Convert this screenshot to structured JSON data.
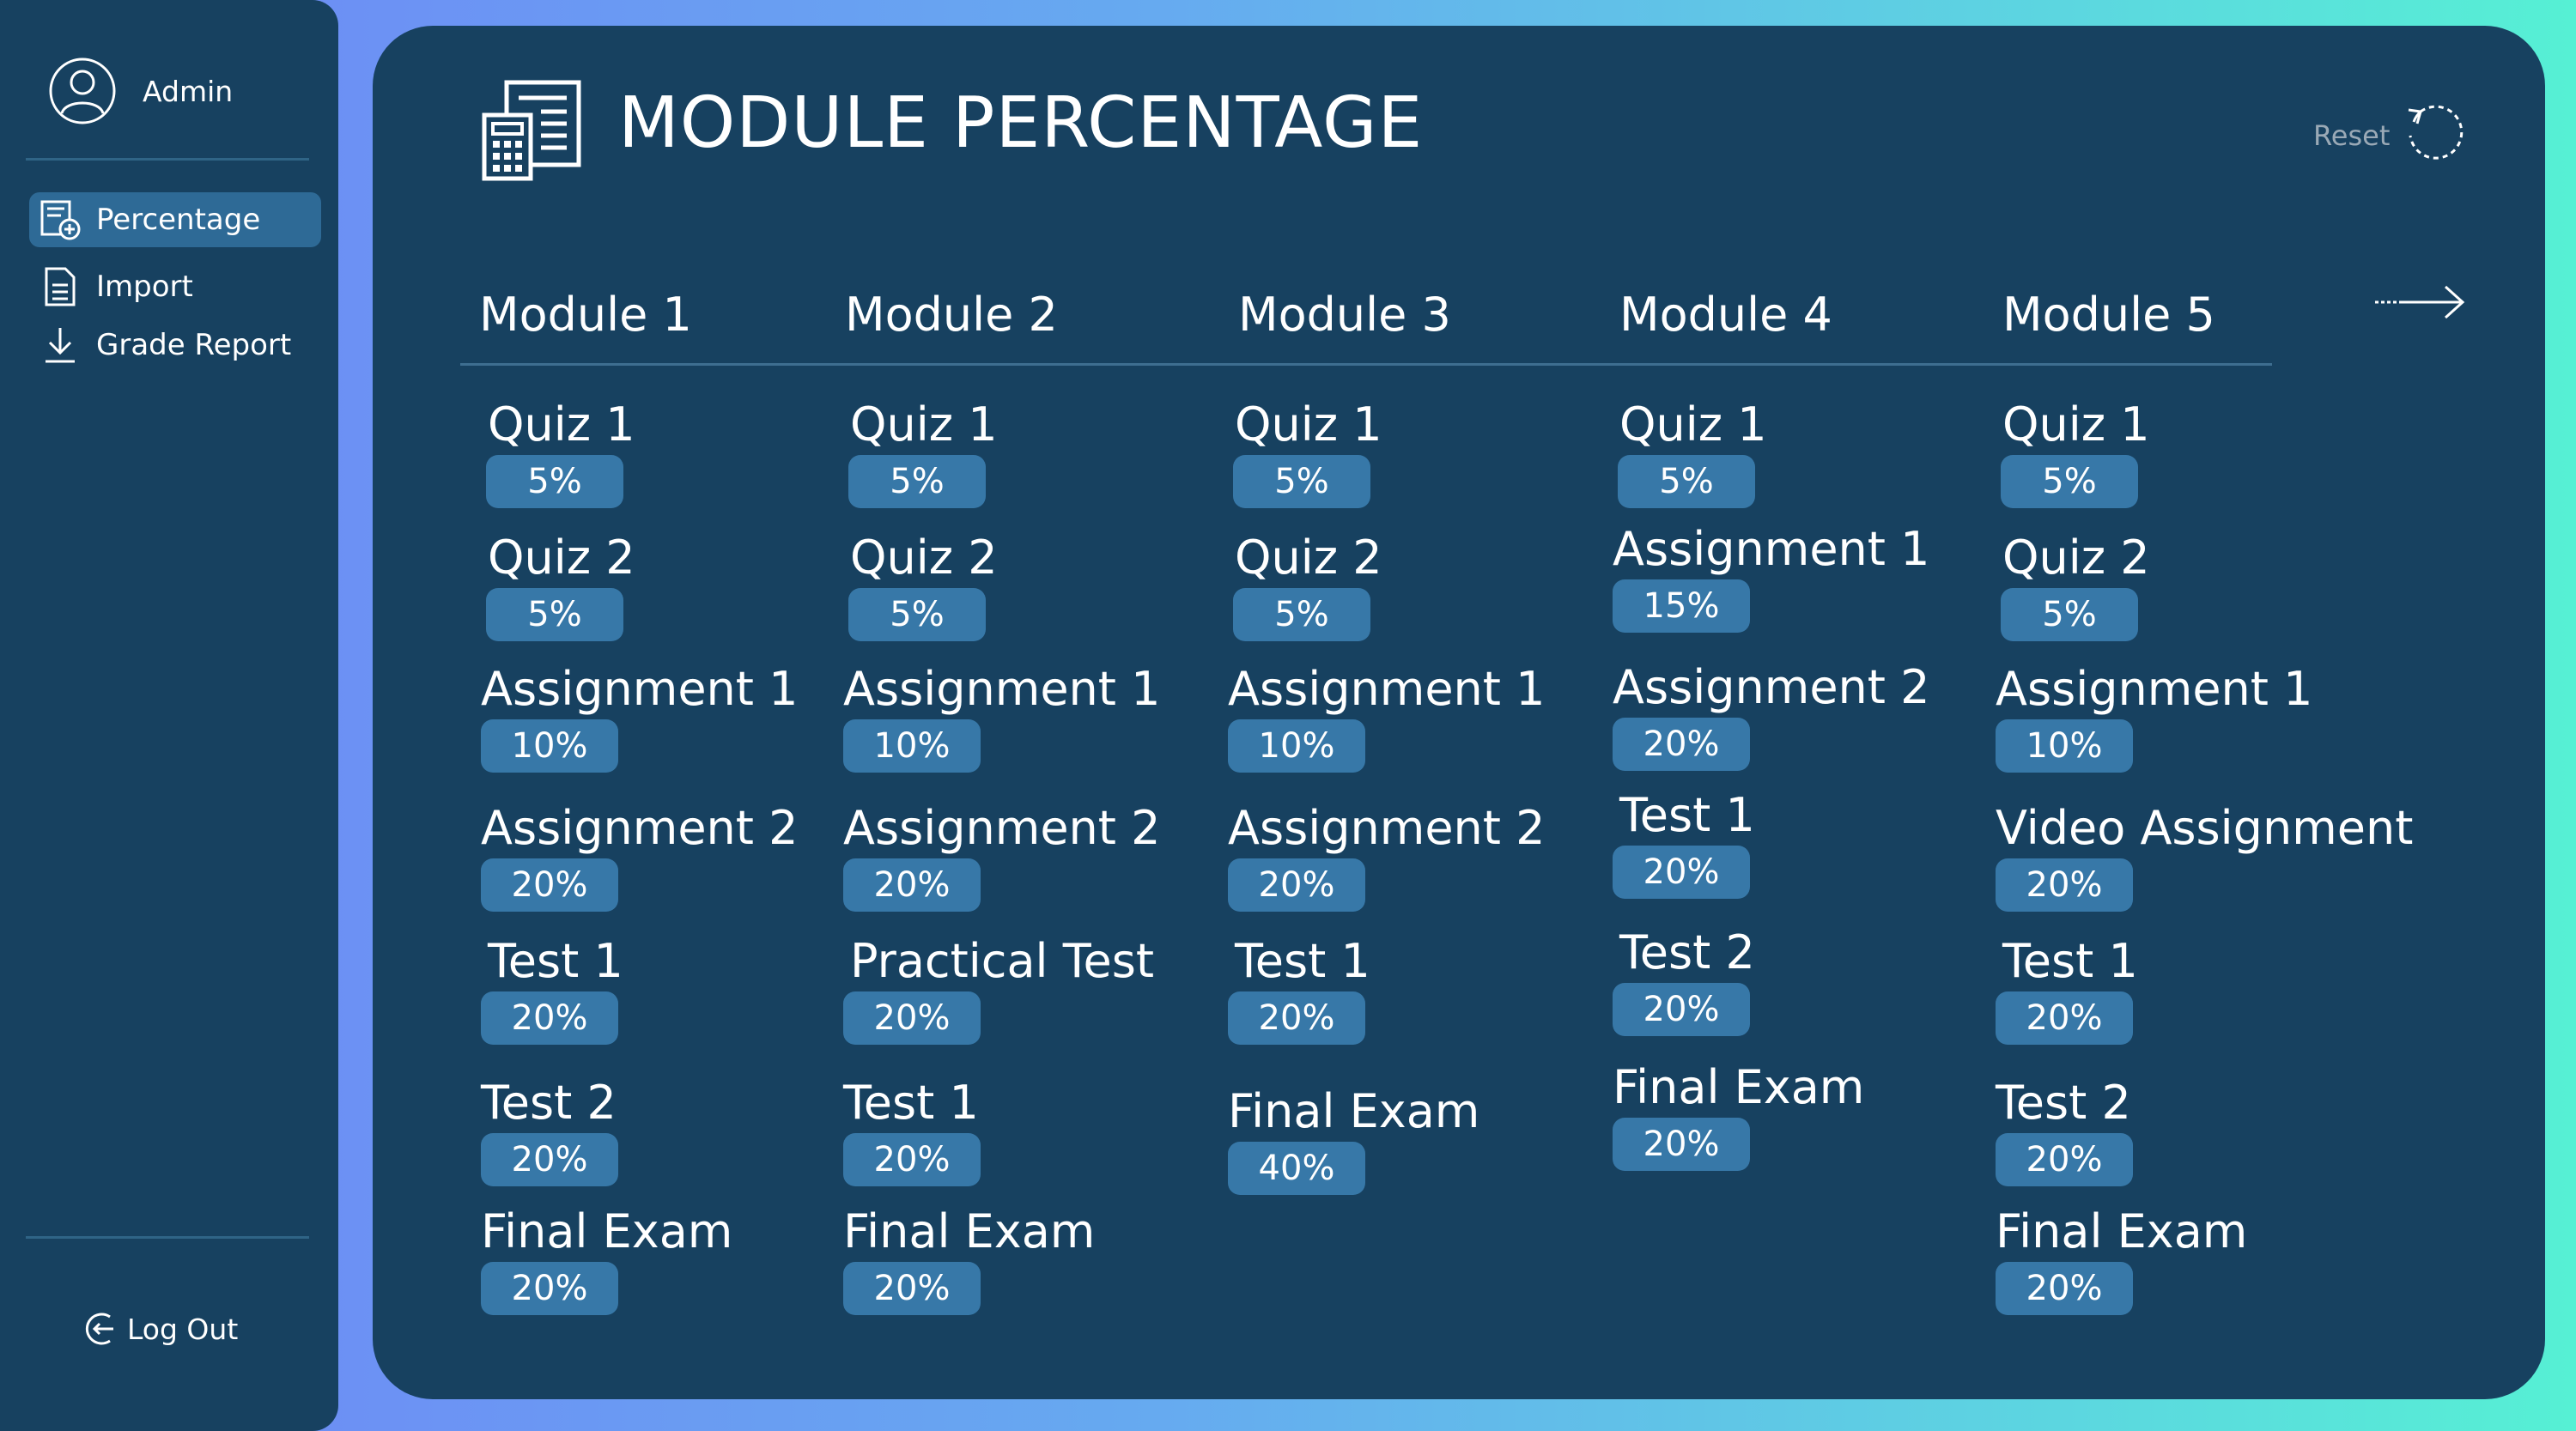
{
  "sidebar": {
    "user": "Admin",
    "nav": [
      {
        "label": "Percentage",
        "icon": "percentage-icon"
      },
      {
        "label": "Import",
        "icon": "document-icon"
      },
      {
        "label": "Grade Report",
        "icon": "download-icon"
      }
    ],
    "logout": "Log Out"
  },
  "header": {
    "title": "MODULE PERCENTAGE",
    "reset": "Reset"
  },
  "modules": [
    {
      "name": "Module 1",
      "items": [
        {
          "name": "Quiz 1",
          "pct": "5%"
        },
        {
          "name": "Quiz 2",
          "pct": "5%"
        },
        {
          "name": "Assignment 1",
          "pct": "10%"
        },
        {
          "name": "Assignment 2",
          "pct": "20%"
        },
        {
          "name": "Test 1",
          "pct": "20%"
        },
        {
          "name": "Test 2",
          "pct": "20%"
        },
        {
          "name": "Final Exam",
          "pct": "20%"
        }
      ]
    },
    {
      "name": "Module 2",
      "items": [
        {
          "name": "Quiz 1",
          "pct": "5%"
        },
        {
          "name": "Quiz 2",
          "pct": "5%"
        },
        {
          "name": "Assignment 1",
          "pct": "10%"
        },
        {
          "name": "Assignment 2",
          "pct": "20%"
        },
        {
          "name": "Practical Test",
          "pct": "20%"
        },
        {
          "name": "Test 1",
          "pct": "20%"
        },
        {
          "name": "Final Exam",
          "pct": "20%"
        }
      ]
    },
    {
      "name": "Module 3",
      "items": [
        {
          "name": "Quiz 1",
          "pct": "5%"
        },
        {
          "name": "Quiz 2",
          "pct": "5%"
        },
        {
          "name": "Assignment 1",
          "pct": "10%"
        },
        {
          "name": "Assignment 2",
          "pct": "20%"
        },
        {
          "name": "Test 1",
          "pct": "20%"
        },
        {
          "name": "Final Exam",
          "pct": "40%"
        }
      ]
    },
    {
      "name": "Module 4",
      "items": [
        {
          "name": "Quiz 1",
          "pct": "5%"
        },
        {
          "name": "Assignment 1",
          "pct": "15%"
        },
        {
          "name": "Assignment 2",
          "pct": "20%"
        },
        {
          "name": "Test 1",
          "pct": "20%"
        },
        {
          "name": "Test 2",
          "pct": "20%"
        },
        {
          "name": "Final Exam",
          "pct": "20%"
        }
      ]
    },
    {
      "name": "Module 5",
      "items": [
        {
          "name": "Quiz 1",
          "pct": "5%"
        },
        {
          "name": "Quiz 2",
          "pct": "5%"
        },
        {
          "name": "Assignment 1",
          "pct": "10%"
        },
        {
          "name": "Video Assignment",
          "pct": "20%"
        },
        {
          "name": "Test 1",
          "pct": "20%"
        },
        {
          "name": "Test 2",
          "pct": "20%"
        },
        {
          "name": "Final Exam",
          "pct": "20%"
        }
      ]
    }
  ]
}
